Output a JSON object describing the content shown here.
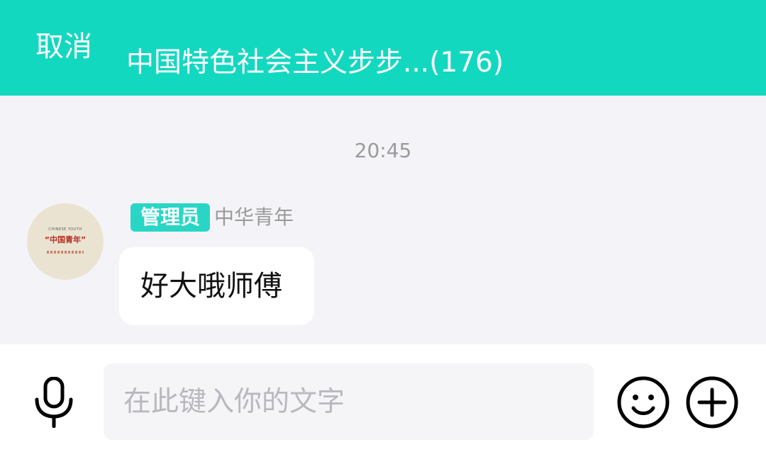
{
  "header": {
    "cancel_label": "取消",
    "title": "中国特色社会主义步步...(176)",
    "background_color": "#13d8c0"
  },
  "chat": {
    "timestamp": "20:45",
    "messages": [
      {
        "avatar": {
          "top_text": "CHINESE YOUTH",
          "main_text": "“中国青年”"
        },
        "role_badge": "管理员",
        "sender": "中华青年",
        "text": "好大哦师傅"
      }
    ]
  },
  "input_bar": {
    "placeholder": "在此键入你的文字",
    "value": "",
    "icons": [
      "microphone-icon",
      "emoji-icon",
      "plus-icon"
    ]
  },
  "colors": {
    "accent": "#13d8c0",
    "badge": "#29d6c6",
    "chat_background": "#f4f4f8"
  }
}
